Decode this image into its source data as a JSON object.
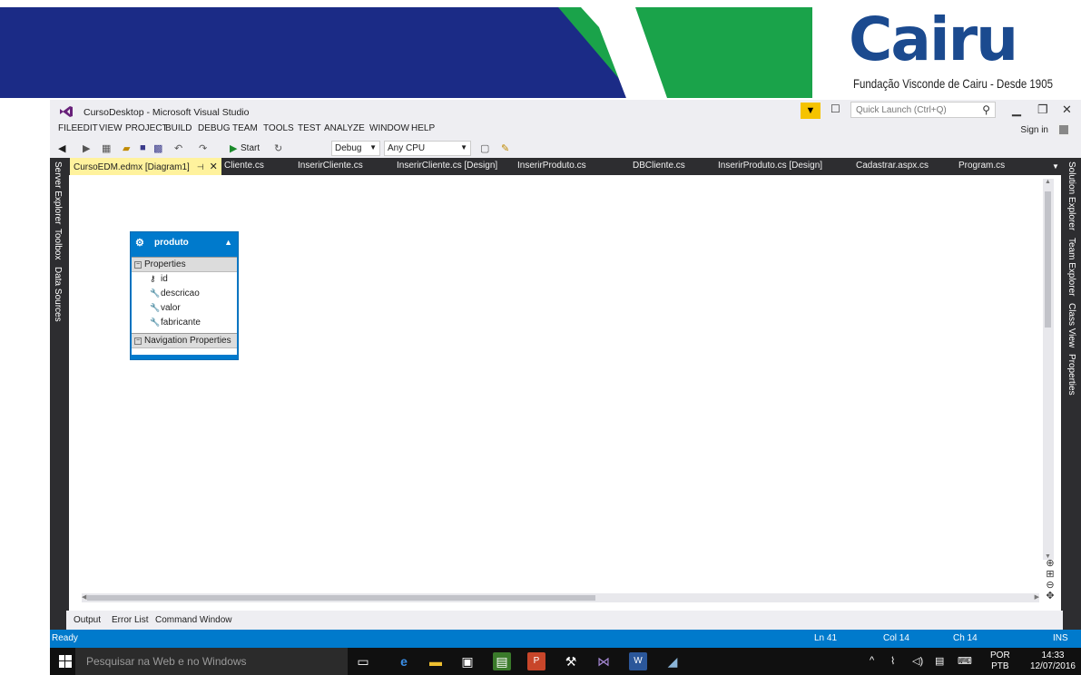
{
  "banner": {
    "brand_word": "Cairu",
    "tagline": "Fundação Visconde de Cairu - Desde 1905",
    "colors": {
      "navy": "#1b2b86",
      "green": "#1aa34a",
      "logo": "#1b4a8f"
    }
  },
  "window": {
    "title": "CursoDesktop - Microsoft Visual Studio",
    "quick_launch_placeholder": "Quick Launch (Ctrl+Q)",
    "sign_in": "Sign in"
  },
  "menu": [
    "FILE",
    "EDIT",
    "VIEW",
    "PROJECT",
    "BUILD",
    "DEBUG",
    "TEAM",
    "TOOLS",
    "TEST",
    "ANALYZE",
    "WINDOW",
    "HELP"
  ],
  "toolbar": {
    "start_label": "Start",
    "config": "Debug",
    "platform": "Any CPU"
  },
  "left_tool_windows": [
    "Server Explorer",
    "Toolbox",
    "Data Sources"
  ],
  "right_tool_windows": [
    "Solution Explorer",
    "Team Explorer",
    "Class View",
    "Properties"
  ],
  "tabs": [
    "CursoEDM.edmx [Diagram1]",
    "Cliente.cs",
    "InserirCliente.cs",
    "InserirCliente.cs [Design]",
    "InserirProduto.cs",
    "DBCliente.cs",
    "InserirProduto.cs [Design]",
    "Cadastrar.aspx.cs",
    "Program.cs"
  ],
  "entity": {
    "name": "produto",
    "properties_header": "Properties",
    "properties": [
      "id",
      "descricao",
      "valor",
      "fabricante"
    ],
    "navigation_header": "Navigation Properties"
  },
  "bottom_tabs": [
    "Output",
    "Error List",
    "Command Window"
  ],
  "status": {
    "state": "Ready",
    "line": "Ln 41",
    "col": "Col 14",
    "ch": "Ch 14",
    "mode": "INS"
  },
  "taskbar": {
    "search_placeholder": "Pesquisar na Web e no Windows",
    "lang_top": "POR",
    "lang_bottom": "PTB",
    "time": "14:33",
    "date": "12/07/2016"
  }
}
